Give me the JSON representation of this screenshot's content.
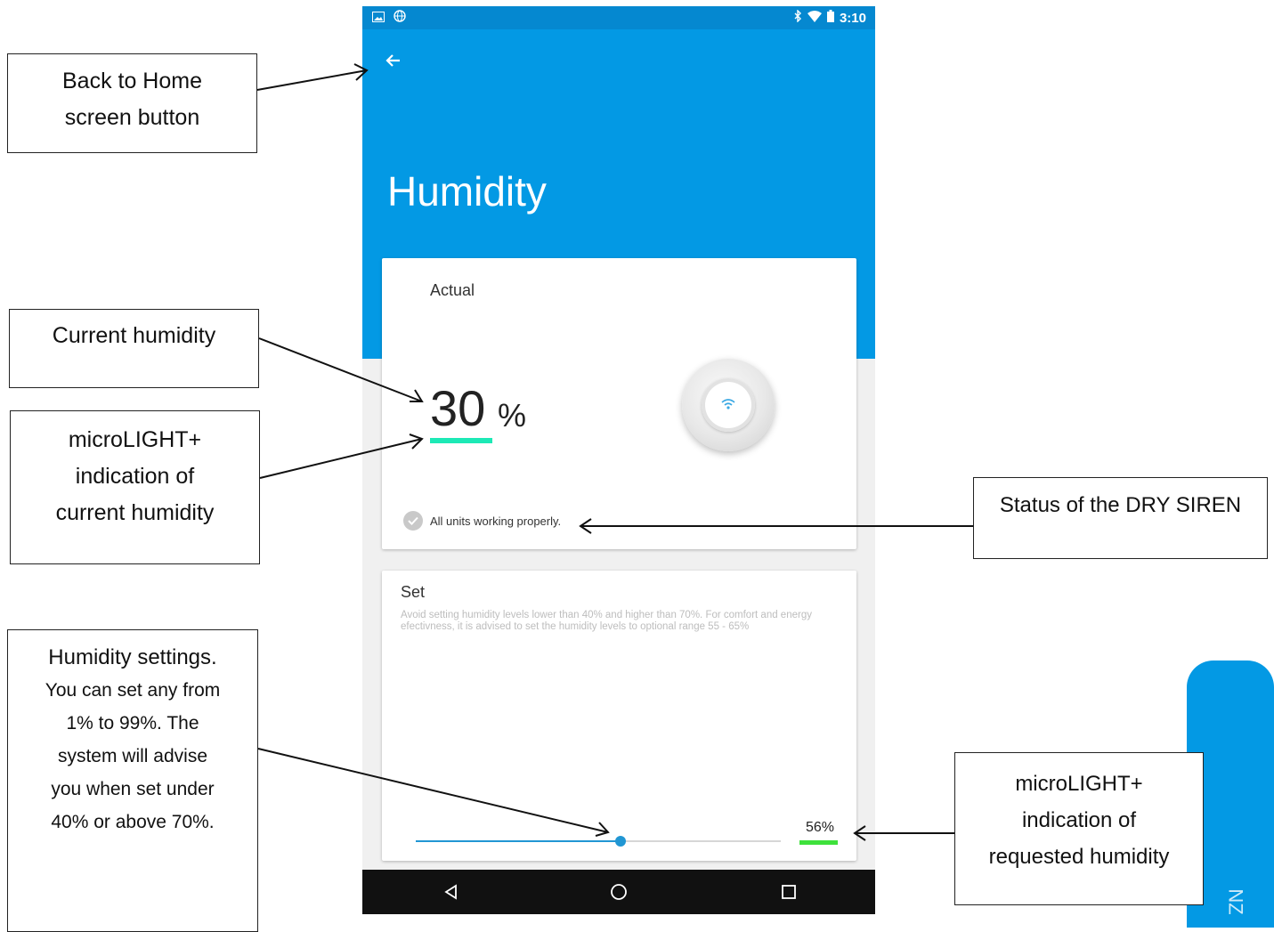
{
  "callouts": {
    "back": "Back to Home\nscreen button",
    "current": "Current humidity",
    "ml_current": "microLIGHT+\nindication of\ncurrent humidity",
    "siren": "Status of the DRY SIREN",
    "settings_first": "Humidity settings.",
    "settings_rest": "You can set any from\n1% to 99%. The\nsystem will advise\nyou when set under\n40% or above 70%.",
    "ml_requested": "microLIGHT+\nindication of\nrequested humidity"
  },
  "status_bar": {
    "time": "3:10",
    "icons_left": [
      "image-icon",
      "globe-icon"
    ],
    "icons_right": [
      "bluetooth-icon",
      "wifi-icon",
      "battery-icon"
    ]
  },
  "header": {
    "title": "Humidity",
    "color": "#0399e4"
  },
  "actual_card": {
    "label": "Actual",
    "value": "30",
    "unit": "%",
    "indicator_color": "#1de9b6",
    "status_text": "All units working properly."
  },
  "set_card": {
    "label": "Set",
    "advice": "Avoid setting humidity levels lower than 40% and higher than 70%. For comfort and energy efectivness, it is advised to set the humidity levels to optional range 55 - 65%",
    "value_text": "56%",
    "slider_value": 0.56,
    "indicator_color": "#3ee13b"
  },
  "side_tab": {
    "text": "NZ"
  }
}
